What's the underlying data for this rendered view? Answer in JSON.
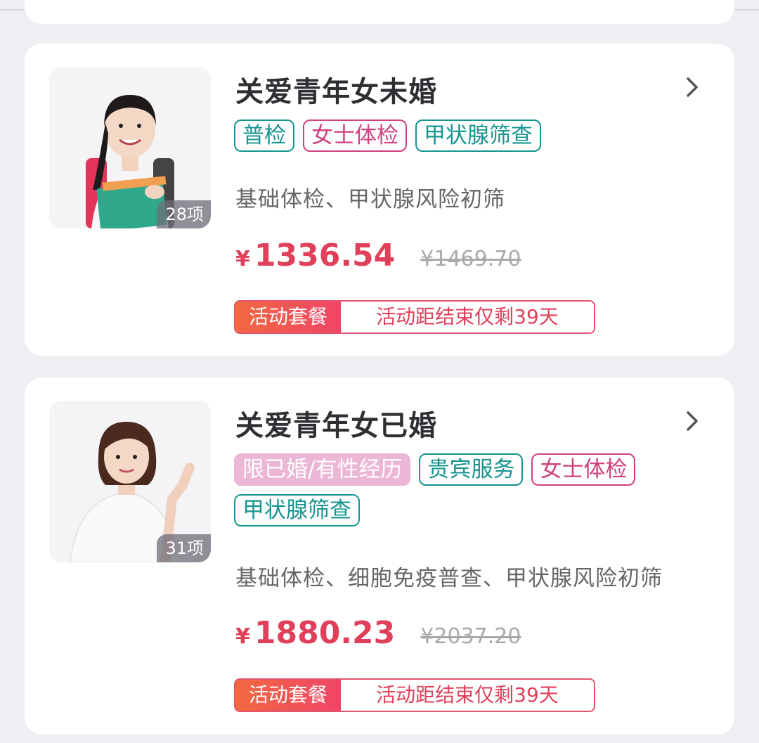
{
  "packages": [
    {
      "title": "关爱青年女未婚",
      "count": "28项",
      "tags": [
        {
          "label": "普检",
          "style": "teal"
        },
        {
          "label": "女士体检",
          "style": "pink"
        },
        {
          "label": "甲状腺筛查",
          "style": "teal"
        }
      ],
      "description": "基础体检、甲状腺风险初筛",
      "currency": "¥",
      "price": "1336.54",
      "original_price": "¥1469.70",
      "promo_label": "活动套餐",
      "promo_text": "活动距结束仅剩39天"
    },
    {
      "title": "关爱青年女已婚",
      "count": "31项",
      "tags": [
        {
          "label": "限已婚/有性经历",
          "style": "pinkfill"
        },
        {
          "label": "贵宾服务",
          "style": "teal"
        },
        {
          "label": "女士体检",
          "style": "pink"
        },
        {
          "label": "甲状腺筛查",
          "style": "teal"
        }
      ],
      "description": "基础体检、细胞免疫普查、甲状腺风险初筛",
      "currency": "¥",
      "price": "1880.23",
      "original_price": "¥2037.20",
      "promo_label": "活动套餐",
      "promo_text": "活动距结束仅剩39天"
    }
  ],
  "colors": {
    "accent": "#e0405a",
    "teal": "#16948f",
    "pink": "#d0407e"
  },
  "icons": {
    "chevron": "chevron-right-icon"
  }
}
